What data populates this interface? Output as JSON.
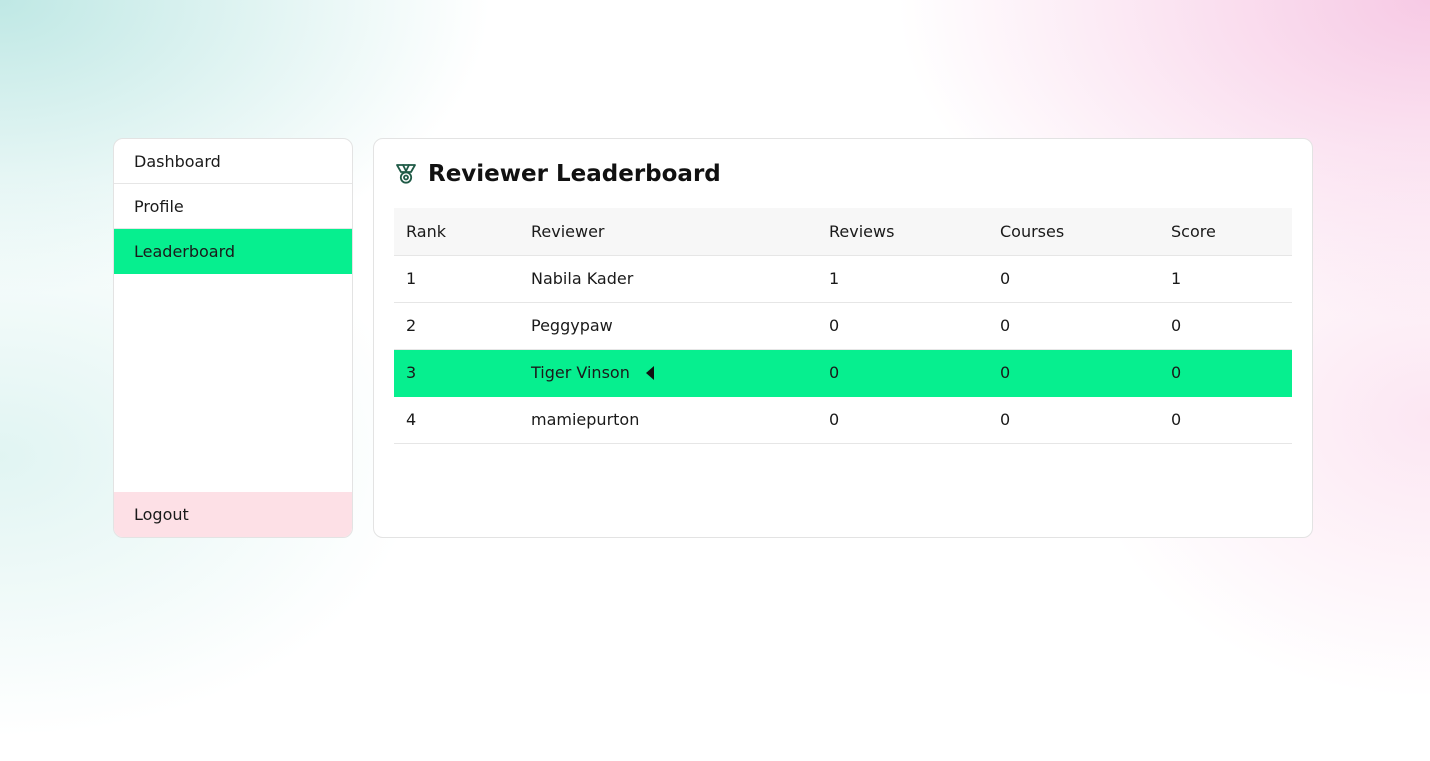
{
  "sidebar": {
    "items": [
      {
        "label": "Dashboard",
        "active": false
      },
      {
        "label": "Profile",
        "active": false
      },
      {
        "label": "Leaderboard",
        "active": true
      }
    ],
    "logout_label": "Logout"
  },
  "panel": {
    "title": "Reviewer Leaderboard",
    "icon": "medal-icon"
  },
  "table": {
    "headers": [
      "Rank",
      "Reviewer",
      "Reviews",
      "Courses",
      "Score"
    ],
    "rows": [
      {
        "rank": "1",
        "reviewer": "Nabila Kader",
        "reviews": "1",
        "courses": "0",
        "score": "1",
        "current_user": false
      },
      {
        "rank": "2",
        "reviewer": "Peggypaw",
        "reviews": "0",
        "courses": "0",
        "score": "0",
        "current_user": false
      },
      {
        "rank": "3",
        "reviewer": "Tiger Vinson",
        "reviews": "0",
        "courses": "0",
        "score": "0",
        "current_user": true
      },
      {
        "rank": "4",
        "reviewer": "mamiepurton",
        "reviews": "0",
        "courses": "0",
        "score": "0",
        "current_user": false
      }
    ]
  },
  "colors": {
    "accent": "#06ef8f",
    "logout_bg": "#fde0e6",
    "header_bg": "#f7f7f7"
  }
}
